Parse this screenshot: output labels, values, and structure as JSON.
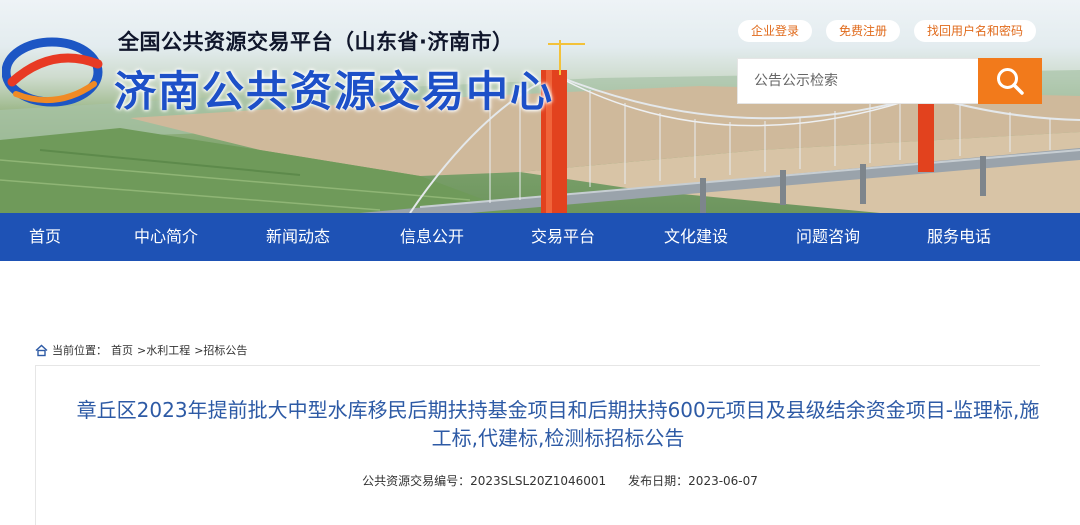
{
  "header": {
    "site_subtitle": "全国公共资源交易平台（山东省·济南市）",
    "site_title": "济南公共资源交易中心",
    "top_links": [
      "企业登录",
      "免费注册",
      "找回用户名和密码"
    ],
    "search": {
      "placeholder": "公告公示检索"
    }
  },
  "nav": {
    "items": [
      "首页",
      "中心简介",
      "新闻动态",
      "信息公开",
      "交易平台",
      "文化建设",
      "问题咨询",
      "服务电话"
    ]
  },
  "breadcrumb": {
    "prefix": "当前位置：",
    "items": [
      "首页",
      ">水利工程",
      ">招标公告"
    ]
  },
  "article": {
    "title": "章丘区2023年提前批大中型水库移民后期扶持基金项目和后期扶持600元项目及县级结余资金项目-监理标,施工标,代建标,检测标招标公告",
    "code_label": "公共资源交易编号：",
    "code": "2023SLSL20Z1046001",
    "date_label": "发布日期：",
    "date": "2023-06-07"
  },
  "colors": {
    "nav_bg": "#1e52b5",
    "accent_orange": "#f27a1b",
    "title_blue": "#2d5aa5"
  }
}
